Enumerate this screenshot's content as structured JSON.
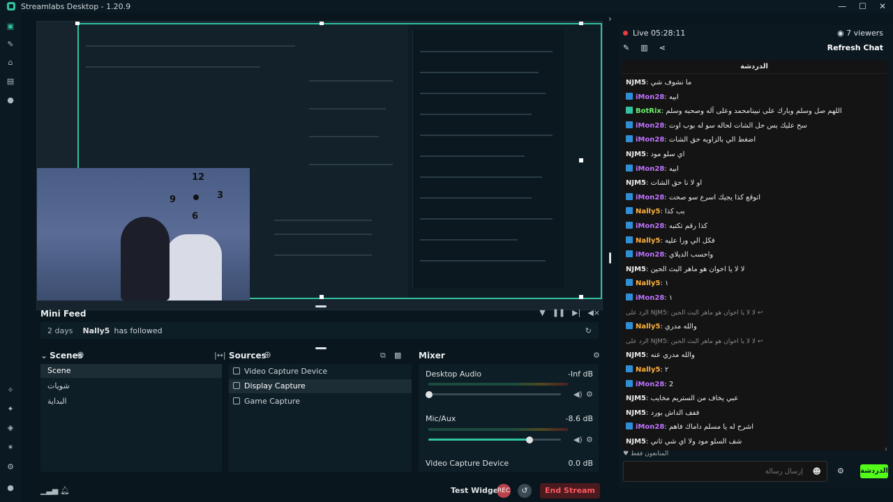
{
  "window": {
    "title": "Streamlabs Desktop - 1.20.9",
    "controls": [
      "—",
      "☐",
      "✕"
    ]
  },
  "rail": {
    "icons": [
      "studio-icon",
      "themes-icon",
      "store-icon",
      "layout-icon",
      "record-icon",
      "editor-icon",
      "alerts-icon",
      "dashboard-icon",
      "magic-icon",
      "settings-icon",
      "profile-icon"
    ]
  },
  "minifeed": {
    "title": "Mini Feed",
    "event": {
      "time": "2 days",
      "user": "Nally5",
      "action": "has followed"
    }
  },
  "scenes": {
    "title": "Scenes",
    "items": [
      "Scene",
      "شويات",
      "البداية"
    ]
  },
  "sources": {
    "title": "Sources",
    "items": [
      "Video Capture Device",
      "Display Capture",
      "Game Capture"
    ]
  },
  "mixer": {
    "title": "Mixer",
    "channels": [
      {
        "name": "Desktop Audio",
        "db": "-Inf dB",
        "level": 0.0
      },
      {
        "name": "Mic/Aux",
        "db": "-8.6 dB",
        "level": 0.76
      },
      {
        "name": "Video Capture Device",
        "db": "0.0 dB",
        "level": 1.0
      }
    ]
  },
  "footer": {
    "test_widgets": "Test Widgets",
    "rec_label": "REC",
    "end_stream": "End Stream"
  },
  "chat": {
    "live": "Live 05:28:11",
    "viewers": "7 viewers",
    "refresh": "Refresh Chat",
    "title": "الدردشة",
    "messages": [
      {
        "user": "NJM5",
        "text": ": ما نشوف شي"
      },
      {
        "user": "iMon28",
        "text": ": ابيه"
      },
      {
        "user": "BotRix",
        "text": ": اللهم صل وسلم وبارك على نبينامحمد وعلى آله وصحبه وسلم"
      },
      {
        "user": "iMon28",
        "text": ": سح عليك بس حل الشات لحاله سو له بوب اوت"
      },
      {
        "user": "iMon28",
        "text": ": اضغط الي بالزاويه حق الشات"
      },
      {
        "user": "NJM5",
        "text": ": اي سلو مود"
      },
      {
        "user": "iMon28",
        "text": ": ابيه"
      },
      {
        "user": "NJM5",
        "text": ": او لا نا حق الشات"
      },
      {
        "user": "iMon28",
        "text": ": اتوقع كذا يجيك اسرع سو صحت"
      },
      {
        "user": "Nally5",
        "text": ": بب كذا"
      },
      {
        "user": "iMon28",
        "text": ": كذا رقم تكتبه"
      },
      {
        "user": "Nally5",
        "text": ": فكل الي ورا عليه"
      },
      {
        "user": "iMon28",
        "text": ": واحسب الديلاي"
      },
      {
        "user": "NJM5",
        "text": ": لا لا يا اخوان هو ماهر البث الحين"
      },
      {
        "user": "Nally5",
        "text": ": ١"
      },
      {
        "user": "iMon28",
        "text": ": ١"
      },
      {
        "reply": "الرد على NJM5: لا لا يا اخوان هو ماهر البث الحين ↩"
      },
      {
        "user": "Nally5",
        "text": ": والله مدري"
      },
      {
        "reply": "الرد على NJM5: لا لا يا اخوان هو ماهر البث الحين ↩"
      },
      {
        "user": "NJM5",
        "text": ": والله مدري عنه"
      },
      {
        "user": "Nally5",
        "text": ": ٢"
      },
      {
        "user": "iMon28",
        "text": ": 2"
      },
      {
        "user": "NJM5",
        "text": ": عبي يخاف من الستريم مخايب"
      },
      {
        "user": "NJM5",
        "text": ": ففف الداش بورد"
      },
      {
        "user": "iMon28",
        "text": ": اشرح له يا مسلم داماك فاهم"
      },
      {
        "user": "NJM5",
        "text": ": شف السلو مود ولا اي شي ثاني"
      }
    ],
    "footer_note": "المتابعون فقط",
    "input_placeholder": "إرسال رسالة",
    "send_label": "الدردشة"
  },
  "colors": {
    "accent": "#31c3a2",
    "end_stream": "#ff5a5f",
    "kick_green": "#53fc18"
  }
}
